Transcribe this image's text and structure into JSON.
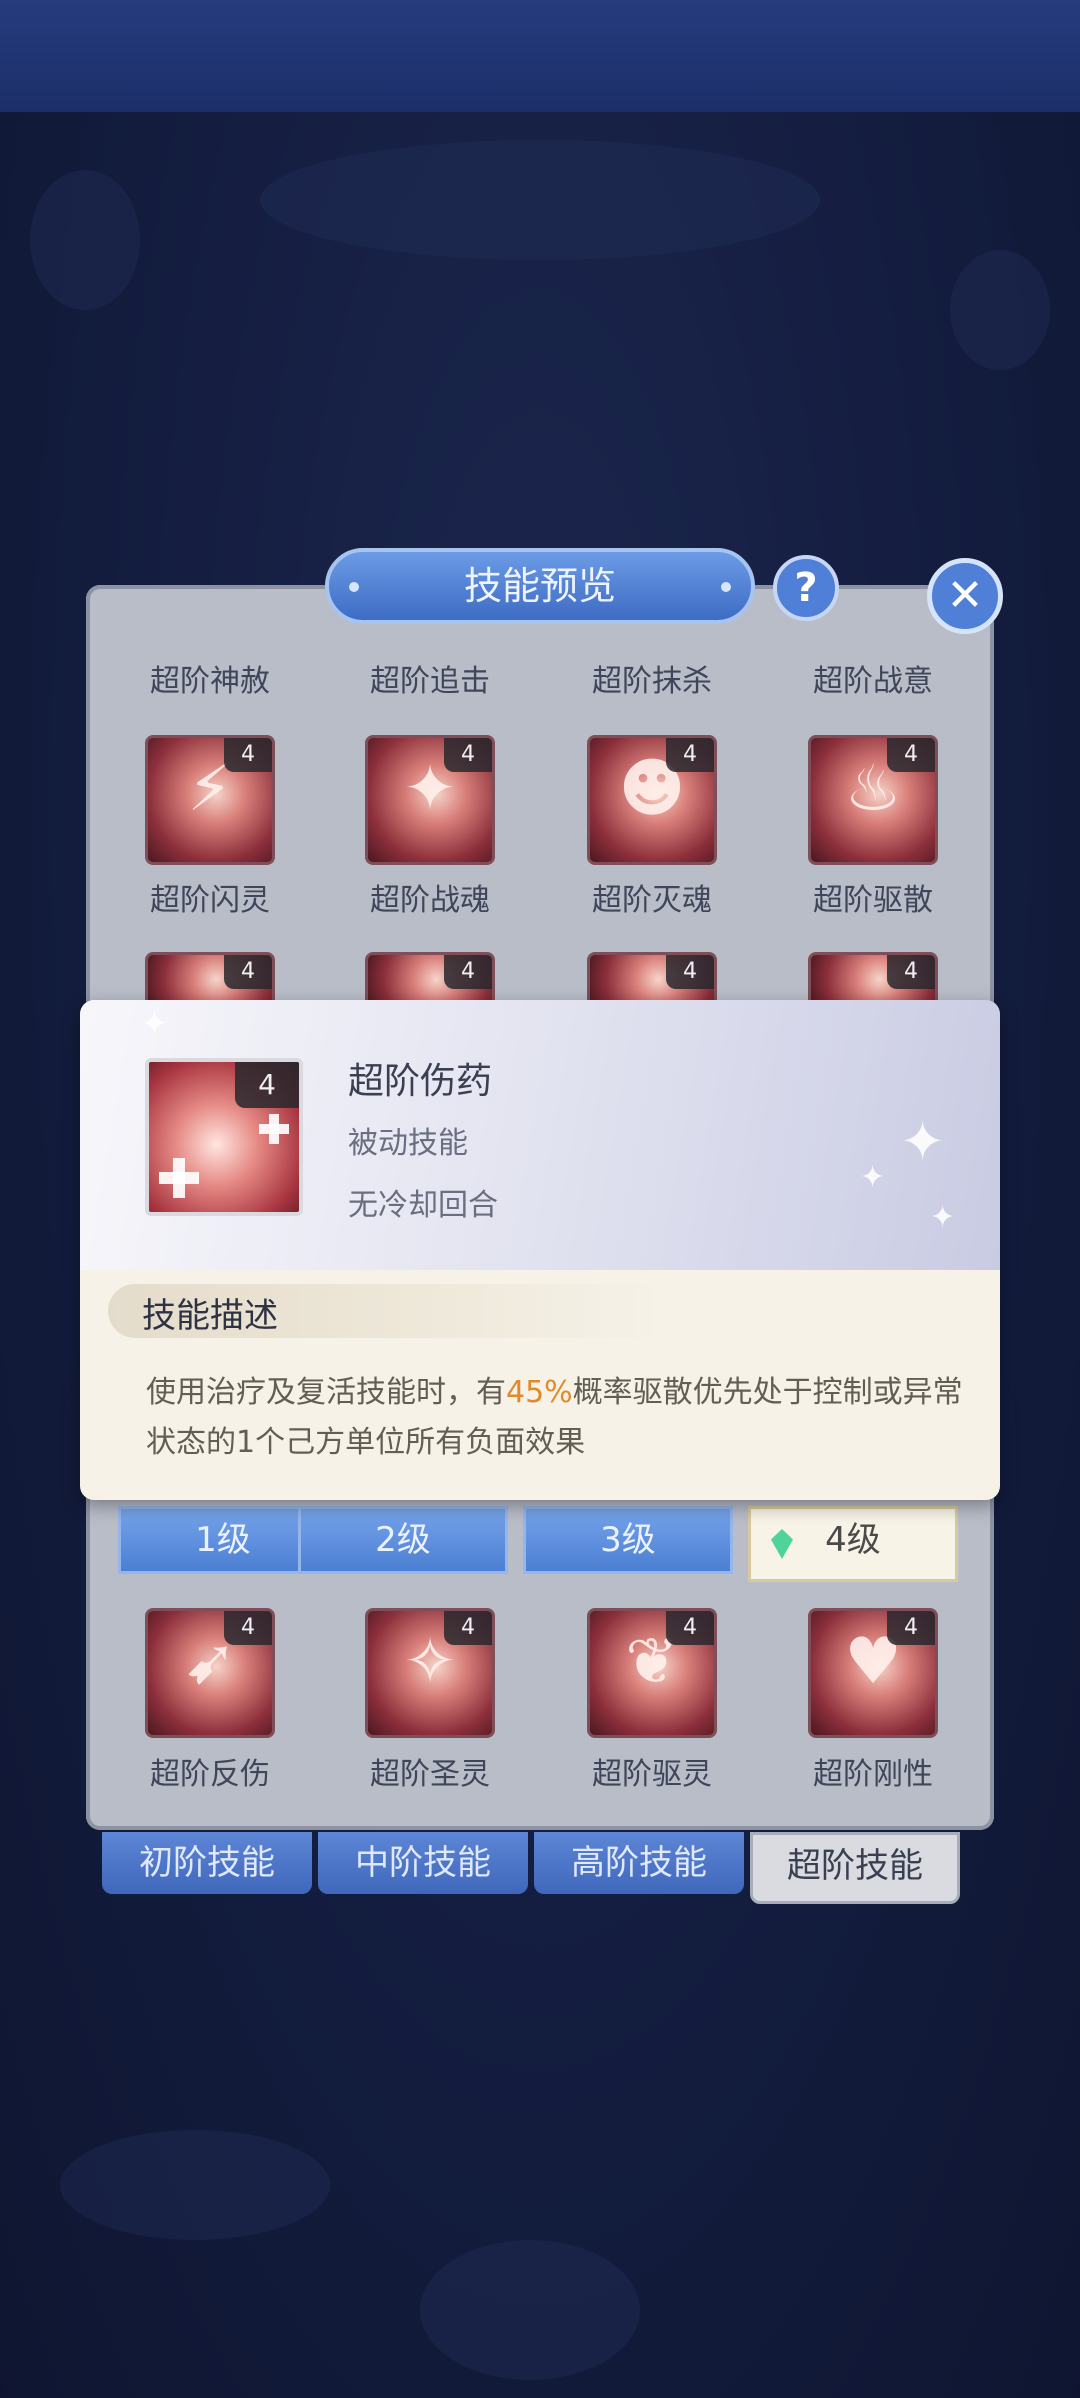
{
  "panel": {
    "title": "技能预览",
    "help_label": "?",
    "close_label": "✕"
  },
  "skills": [
    {
      "name": "超阶神赦",
      "level": ""
    },
    {
      "name": "超阶追击",
      "level": ""
    },
    {
      "name": "超阶抹杀",
      "level": ""
    },
    {
      "name": "超阶战意",
      "level": ""
    },
    {
      "name": "超阶闪灵",
      "level": "4"
    },
    {
      "name": "超阶战魂",
      "level": "4"
    },
    {
      "name": "超阶灭魂",
      "level": "4"
    },
    {
      "name": "超阶驱散",
      "level": "4"
    },
    {
      "name": "超阶反伤",
      "level": "4"
    },
    {
      "name": "超阶圣灵",
      "level": "4"
    },
    {
      "name": "超阶驱灵",
      "level": "4"
    },
    {
      "name": "超阶刚性",
      "level": "4"
    }
  ],
  "level_tabs": [
    {
      "label": "1级",
      "active": false
    },
    {
      "label": "2级",
      "active": false
    },
    {
      "label": "3级",
      "active": false
    },
    {
      "label": "4级",
      "active": true
    }
  ],
  "tier_tabs": [
    {
      "label": "初阶技能",
      "active": false
    },
    {
      "label": "中阶技能",
      "active": false
    },
    {
      "label": "高阶技能",
      "active": false
    },
    {
      "label": "超阶技能",
      "active": true
    }
  ],
  "popup": {
    "skill_name": "超阶伤药",
    "level": "4",
    "skill_type": "被动技能",
    "cooldown": "无冷却回合",
    "desc_title": "技能描述",
    "desc_before": "使用治疗及复活技能时，有",
    "desc_highlight": "45%",
    "desc_after": "概率驱散优先处于控制或异常状态的1个己方单位所有负面效果"
  },
  "colors": {
    "highlight": "#e08a2a",
    "tab_blue": "#4c7fd3",
    "panel_gray": "#b9bdc8"
  }
}
